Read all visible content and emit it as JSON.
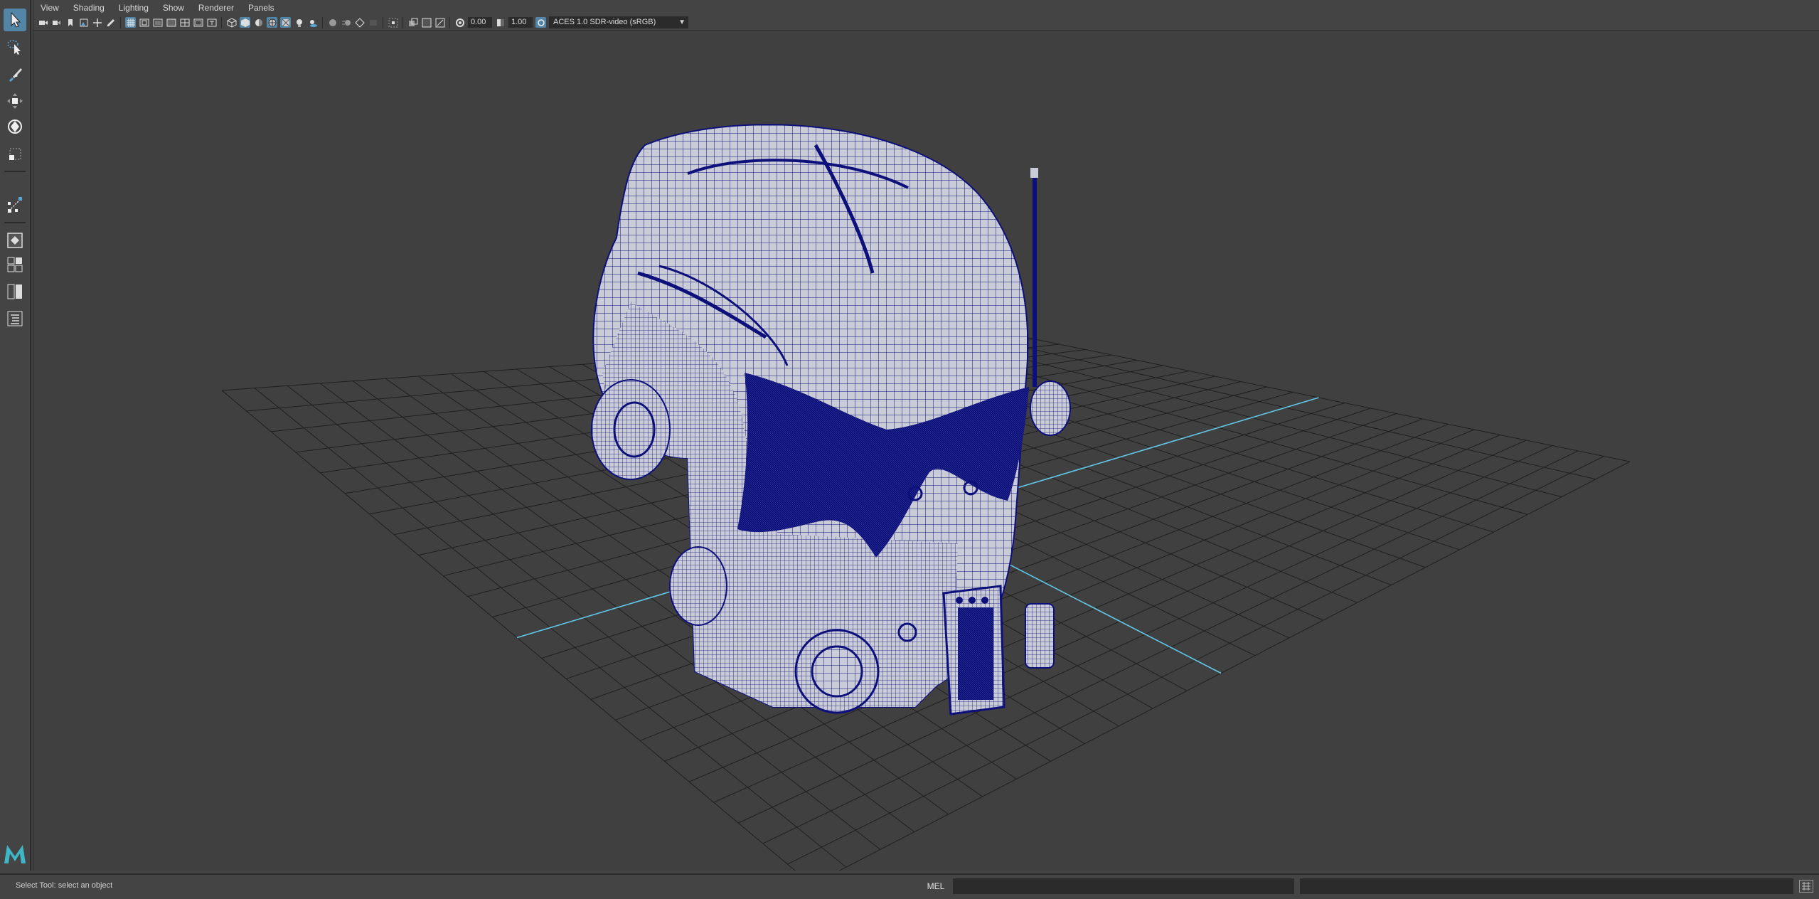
{
  "panel_menu": [
    "View",
    "Shading",
    "Lighting",
    "Show",
    "Renderer",
    "Panels"
  ],
  "toolbar": {
    "near_exposure": "0.00",
    "gamma": "1.00",
    "color_space": "ACES 1.0 SDR-video (sRGB)"
  },
  "tools": [
    {
      "name": "select-tool-icon",
      "active": true
    },
    {
      "name": "lasso-tool-icon",
      "active": false
    },
    {
      "name": "paint-select-tool-icon",
      "active": false
    },
    {
      "name": "move-tool-icon",
      "active": false
    },
    {
      "name": "rotate-tool-icon",
      "active": false
    },
    {
      "name": "scale-tool-icon",
      "active": false
    }
  ],
  "status": {
    "help_line": "Select Tool: select an object",
    "command_language": "MEL"
  },
  "colors": {
    "viewport_bg": "#404040",
    "grid": "#1f1f1f",
    "axis": "#61c8ea",
    "wireframe": "#0d0f7a",
    "model_fill": "#c9cbd6",
    "active_tool": "#5285a6"
  }
}
